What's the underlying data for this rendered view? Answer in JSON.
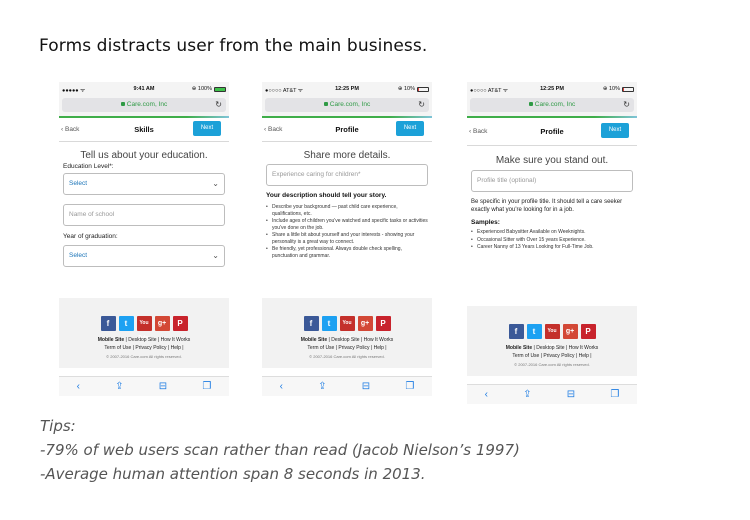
{
  "slide_title": "Forms distracts user from the main business.",
  "phones": [
    {
      "status": {
        "carrier": "●●●●● ᯤ",
        "time": "9:41 AM",
        "battery": "⊕ 100%",
        "battery_level": 1.0
      },
      "url": "Care.com, Inc",
      "nav": {
        "back": "Back",
        "title": "Skills",
        "next": "Next"
      },
      "heading": "Tell us about your education.",
      "education_label": "Education Level*:",
      "education_select": "Select",
      "school_placeholder": "Name of school",
      "year_label": "Year of graduation:",
      "year_select": "Select"
    },
    {
      "status": {
        "carrier": "●○○○○ AT&T ᯤ",
        "time": "12:25 PM",
        "battery": "⊕ 10%",
        "battery_level": 0.1
      },
      "url": "Care.com, Inc",
      "nav": {
        "back": "Back",
        "title": "Profile",
        "next": "Next"
      },
      "heading": "Share more details.",
      "experience_placeholder": "Experience caring for children*",
      "description_bold": "Your description should tell your story.",
      "bullets": [
        "Describe your background — past child care experience, qualifications, etc.",
        "Include ages of children you've watched and specific tasks or activities you've done on the job.",
        "Share a little bit about yourself and your interests - showing your personality is a great way to connect.",
        "Be friendly, yet professional. Always double check spelling, punctuation and grammar."
      ]
    },
    {
      "status": {
        "carrier": "●○○○○ AT&T ᯤ",
        "time": "12:25 PM",
        "battery": "⊕ 10%",
        "battery_level": 0.1
      },
      "url": "Care.com, Inc",
      "nav": {
        "back": "Back",
        "title": "Profile",
        "next": "Next"
      },
      "heading": "Make sure you stand out.",
      "title_placeholder": "Profile title (optional)",
      "specific_text": "Be specific in your profile title. It should tell a care seeker exactly what you're looking for in a job.",
      "samples_label": "Samples:",
      "samples": [
        "Experienced Babysitter Available on Weeknights.",
        "Occasional Sitter with Over 15 years Experience.",
        "Career Nanny of 13 Years Looking for Full-Time Job."
      ]
    }
  ],
  "footer": {
    "social": {
      "facebook": "f",
      "twitter": "t",
      "youtube": "You Tube",
      "googleplus": "g+",
      "pinterest": "P"
    },
    "mobile_site": "Mobile Site",
    "links_row1_rest": " | Desktop Site | How It Works",
    "links_row2": "Term of Use | Privacy Policy | Help |",
    "copyright": "© 2007-2016 Care.com All rights reserved."
  },
  "toolbar_icons": [
    "back-icon",
    "share-icon",
    "bookmarks-icon",
    "tabs-icon"
  ],
  "tips": {
    "title": "Tips:",
    "line1": "-79% of web users scan rather than read (Jacob Nielson’s 1997)",
    "line2": "-Average human attention span 8 seconds in 2013."
  },
  "colors": {
    "next_button": "#1ca1d8",
    "url_green": "#2f9a45",
    "link_blue": "#1b74b8"
  }
}
